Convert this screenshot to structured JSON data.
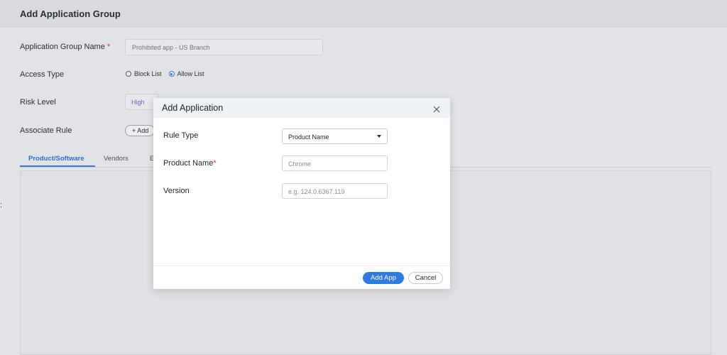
{
  "page": {
    "title": "Add Application Group",
    "group_name": {
      "label": "Application Group Name",
      "required": "*",
      "value": "Prohibited app - US Branch"
    },
    "access_type": {
      "label": "Access Type",
      "options": [
        "Block List",
        "Allow List"
      ],
      "selected": "Allow List"
    },
    "risk_level": {
      "label": "Risk Level",
      "value": "High"
    },
    "associate_rule": {
      "label": "Associate Rule",
      "button": "+ Add"
    },
    "tabs": [
      "Product/Software",
      "Vendors",
      "E"
    ],
    "active_tab": "Product/Software",
    "left_glyph": ":"
  },
  "modal": {
    "title": "Add Application",
    "close_icon": "close-icon",
    "rule_type": {
      "label": "Rule Type",
      "value": "Product Name"
    },
    "product_name": {
      "label": "Product Name",
      "required": "*",
      "placeholder": "Chrome"
    },
    "version": {
      "label": "Version",
      "placeholder": "e.g. 124.0.6367.119"
    },
    "buttons": {
      "add": "Add App",
      "cancel": "Cancel"
    }
  },
  "colors": {
    "accent": "#2f7ae0",
    "required": "#d13a3a",
    "risk_high": "#7c5ac4"
  }
}
